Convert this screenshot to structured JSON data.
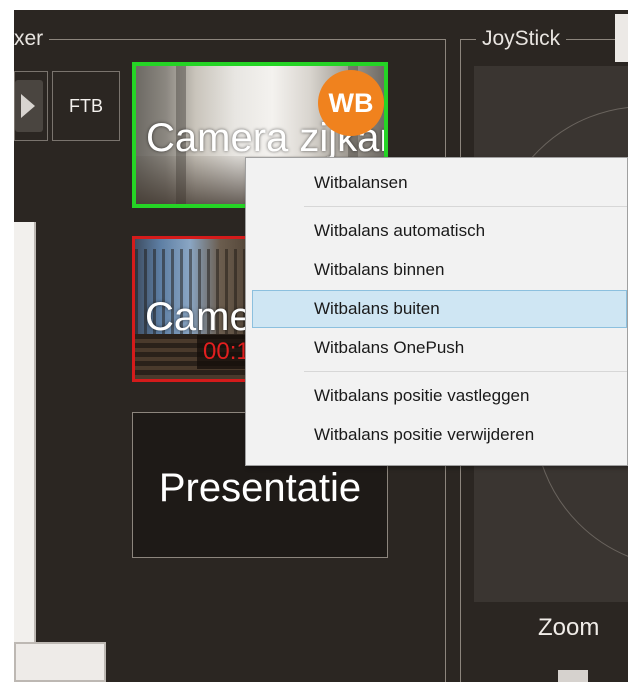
{
  "mixer": {
    "title": "xer",
    "ftb_label": "FTB",
    "cameras": [
      {
        "label": "Camera zijkant",
        "status": "preview",
        "border_color": "#25d425",
        "badge": "WB"
      },
      {
        "label": "Camera",
        "status": "program",
        "border_color": "#d41b1b",
        "timer": "00:1"
      }
    ],
    "presentation_label": "Presentatie"
  },
  "joystick": {
    "title": "JoyStick",
    "zoom_label": "Zoom"
  },
  "context_menu": {
    "items": [
      {
        "label": "Witbalansen",
        "highlighted": false
      },
      {
        "label": "Witbalans automatisch",
        "highlighted": false
      },
      {
        "label": "Witbalans binnen",
        "highlighted": false
      },
      {
        "label": "Witbalans buiten",
        "highlighted": true
      },
      {
        "label": "Witbalans OnePush",
        "highlighted": false
      },
      {
        "label": "Witbalans positie vastleggen",
        "highlighted": false
      },
      {
        "label": "Witbalans positie verwijderen",
        "highlighted": false
      }
    ]
  },
  "colors": {
    "app_background": "#2b2622",
    "preview_border": "#25d425",
    "program_border": "#d41b1b",
    "badge": "#f0821e",
    "menu_highlight": "#cfe6f3"
  }
}
